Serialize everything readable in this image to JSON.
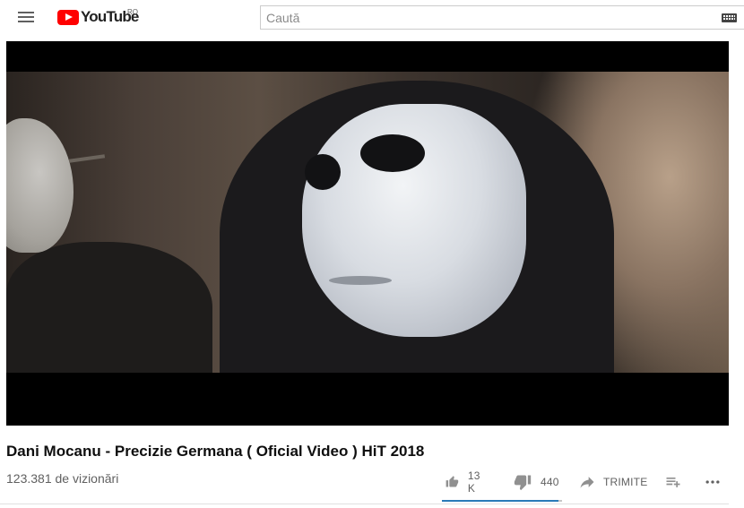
{
  "header": {
    "logo_text": "YouTube",
    "region": "RO",
    "menu_icon": "hamburger-menu-icon",
    "search": {
      "placeholder": "Caută",
      "value": ""
    },
    "keyboard_icon": "keyboard-icon"
  },
  "video": {
    "title": "Dani Mocanu - Precizie Germana ( Oficial Video ) HiT 2018",
    "views": "123.381 de vizionări",
    "likes": "13 K",
    "dislikes": "440",
    "share_label": "TRIMITE",
    "like_ratio": 0.97
  },
  "colors": {
    "brand": "#ff0000",
    "sentiment_fill": "#2a7ab8",
    "sentiment_track": "#c6c6c6"
  }
}
